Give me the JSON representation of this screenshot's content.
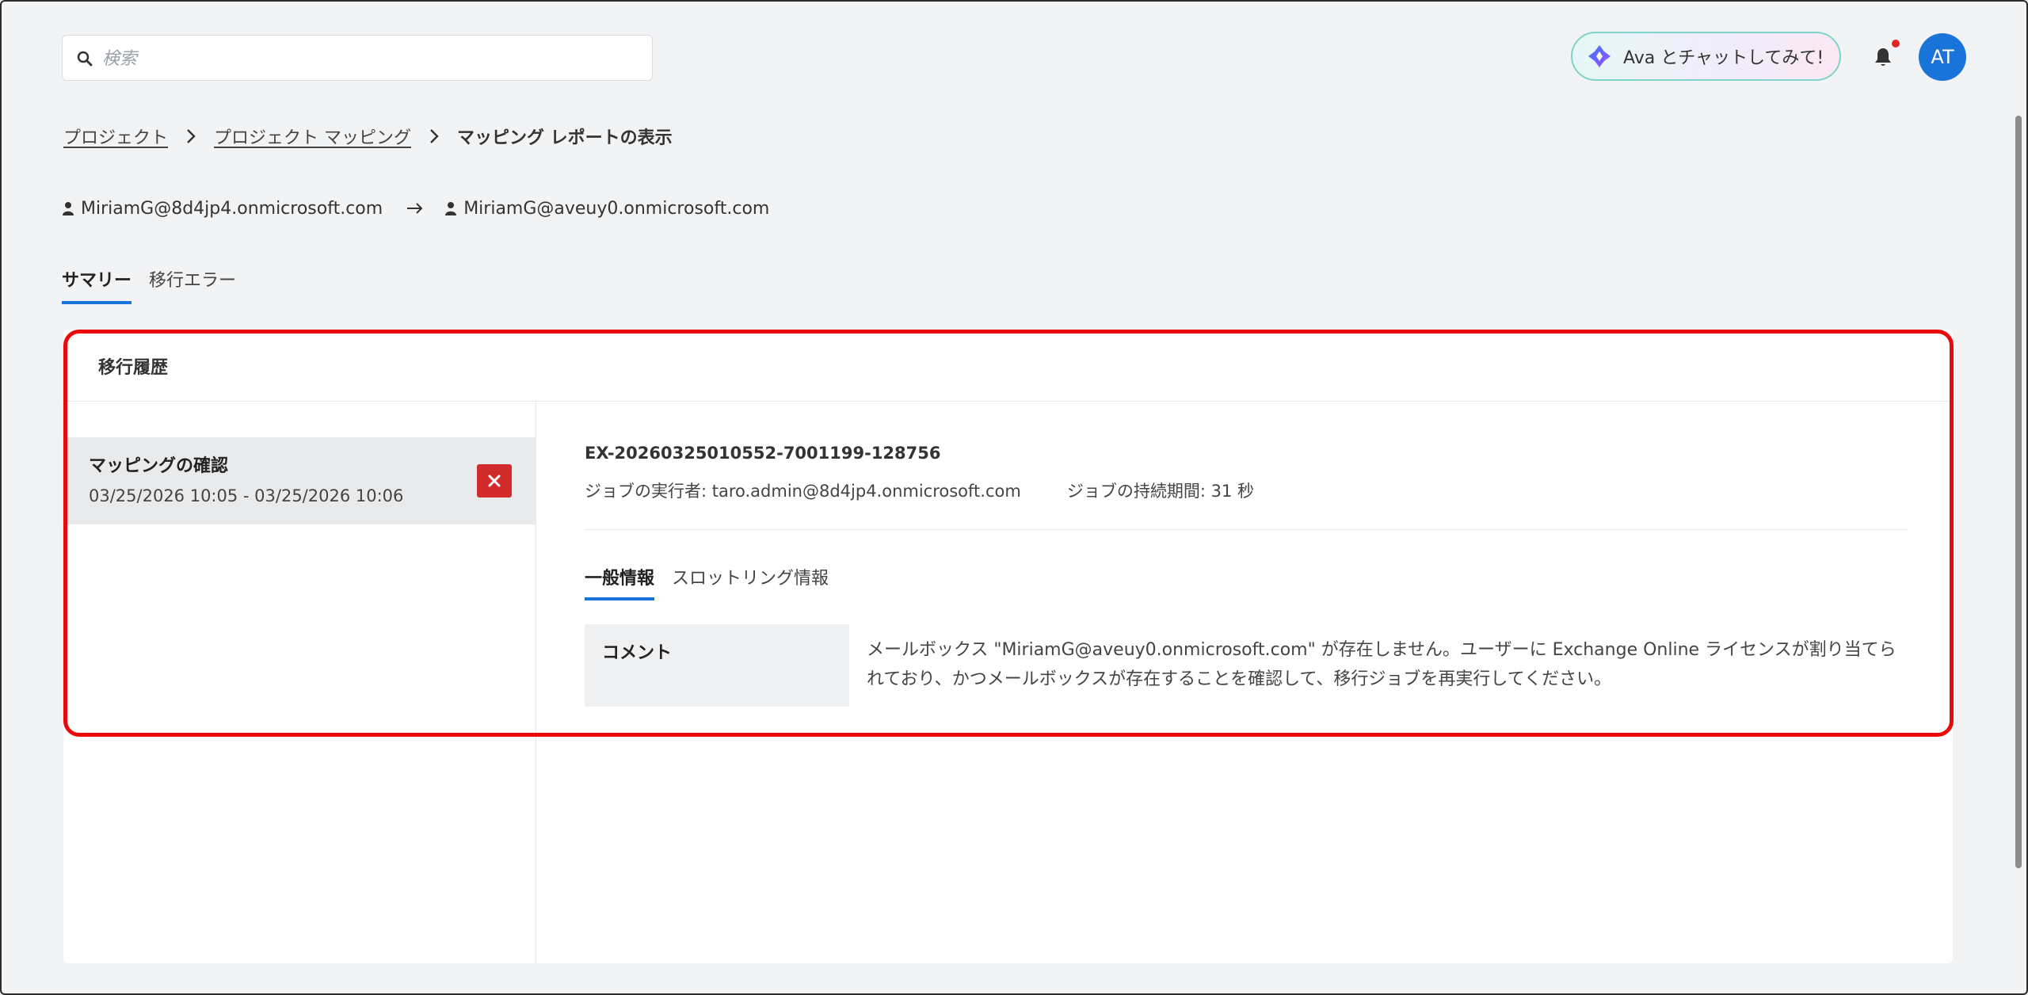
{
  "search": {
    "placeholder": "検索"
  },
  "header": {
    "ava_label": "Ava とチャットしてみて!",
    "avatar_initials": "AT"
  },
  "breadcrumb": {
    "items": [
      "プロジェクト",
      "プロジェクト マッピング"
    ],
    "current": "マッピング レポートの表示"
  },
  "mapping": {
    "source": "MiriamG@8d4jp4.onmicrosoft.com",
    "target": "MiriamG@aveuy0.onmicrosoft.com"
  },
  "tabs": [
    "サマリー",
    "移行エラー"
  ],
  "card": {
    "title": "移行履歴",
    "history": {
      "name": "マッピングの確認",
      "dates": "03/25/2026 10:05 - 03/25/2026 10:06",
      "status": "failed"
    },
    "job": {
      "id": "EX-20260325010552-7001199-128756",
      "executor": "ジョブの実行者: taro.admin@8d4jp4.onmicrosoft.com",
      "duration": "ジョブの持続期間: 31 秒"
    },
    "subtabs": [
      "一般情報",
      "スロットリング情報"
    ],
    "comment_label": "コメント",
    "comment_line1": "メールボックス \"MiriamG@aveuy0.onmicrosoft.com\" が存在しません。ユーザーに Exchange Online ライセンスが割り当てら",
    "comment_line2": "れており、かつメールボックスが存在することを確認して、移行ジョブを再実行してください。"
  },
  "colors": {
    "accent": "#1a73d9",
    "error": "#d12b2b",
    "highlight": "#ea0a0a"
  },
  "icons": [
    "search-icon",
    "ava-logo-icon",
    "bell-icon",
    "chevron-right-icon",
    "person-icon",
    "arrow-right-icon",
    "close-icon"
  ]
}
